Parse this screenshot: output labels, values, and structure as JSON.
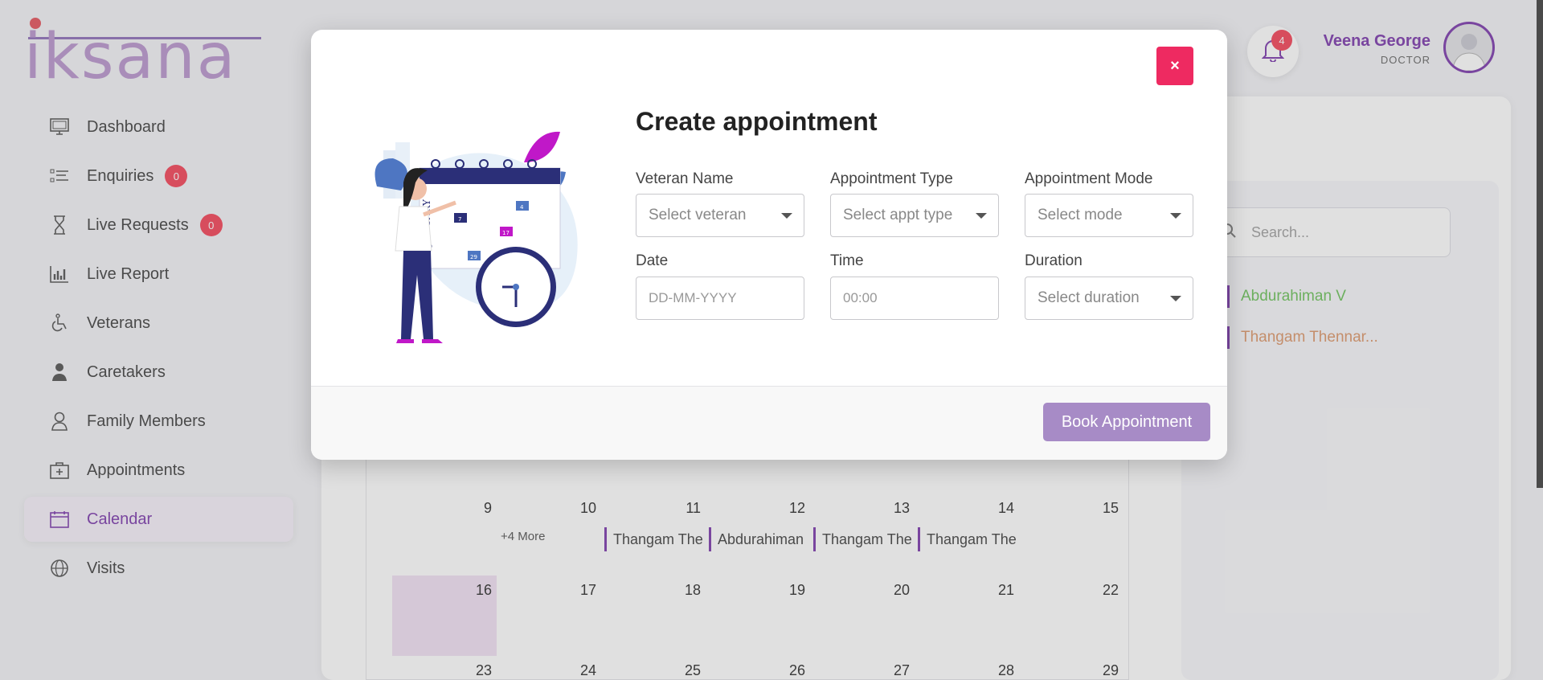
{
  "logo": {
    "text": "iksana"
  },
  "sidebar": {
    "items": [
      {
        "label": "Dashboard",
        "icon": "monitor-icon"
      },
      {
        "label": "Enquiries",
        "icon": "list-icon",
        "badge": "0"
      },
      {
        "label": "Live Requests",
        "icon": "hourglass-icon",
        "badge": "0"
      },
      {
        "label": "Live Report",
        "icon": "bar-chart-icon"
      },
      {
        "label": "Veterans",
        "icon": "wheelchair-icon"
      },
      {
        "label": "Caretakers",
        "icon": "doctor-icon"
      },
      {
        "label": "Family Members",
        "icon": "person-icon"
      },
      {
        "label": "Appointments",
        "icon": "medical-bag-icon"
      },
      {
        "label": "Calendar",
        "icon": "calendar-icon",
        "active": true
      },
      {
        "label": "Visits",
        "icon": "globe-icon"
      }
    ]
  },
  "header": {
    "notification_count": "4",
    "user_name": "Veena George",
    "user_role": "DOCTOR"
  },
  "right_panel": {
    "search_placeholder": "Search...",
    "patients": [
      {
        "name": "Abdurahiman V",
        "color": "#7bc86c"
      },
      {
        "name": "Thangam Thennar...",
        "color": "#e0a27a"
      }
    ]
  },
  "calendar": {
    "partial_label": "...",
    "week1": [
      "9",
      "10",
      "11",
      "12",
      "13",
      "14",
      "15"
    ],
    "week2": [
      "16",
      "17",
      "18",
      "19",
      "20",
      "21",
      "22"
    ],
    "week3": [
      "23",
      "24",
      "25",
      "26",
      "27",
      "28",
      "29"
    ],
    "more_label": "+4 More",
    "events": [
      "Thangam The",
      "Abdurahiman",
      "Thangam The",
      "Thangam The"
    ]
  },
  "modal": {
    "title": "Create appointment",
    "close_label": "×",
    "fields": {
      "veteran": {
        "label": "Veteran Name",
        "placeholder": "Select veteran"
      },
      "appt_type": {
        "label": "Appointment Type",
        "placeholder": "Select appt type"
      },
      "appt_mode": {
        "label": "Appointment Mode",
        "placeholder": "Select mode"
      },
      "date": {
        "label": "Date",
        "placeholder": "DD-MM-YYYY"
      },
      "time": {
        "label": "Time",
        "placeholder": "00:00"
      },
      "duration": {
        "label": "Duration",
        "placeholder": "Select duration"
      }
    },
    "illustration": {
      "month_label": "JANUARY",
      "dates": [
        "7",
        "4",
        "17",
        "29"
      ]
    },
    "book_button": "Book Appointment"
  },
  "colors": {
    "accent": "#8a4fb5",
    "close": "#ee2a61",
    "book": "#a78bc6",
    "badge": "#f5586a"
  }
}
